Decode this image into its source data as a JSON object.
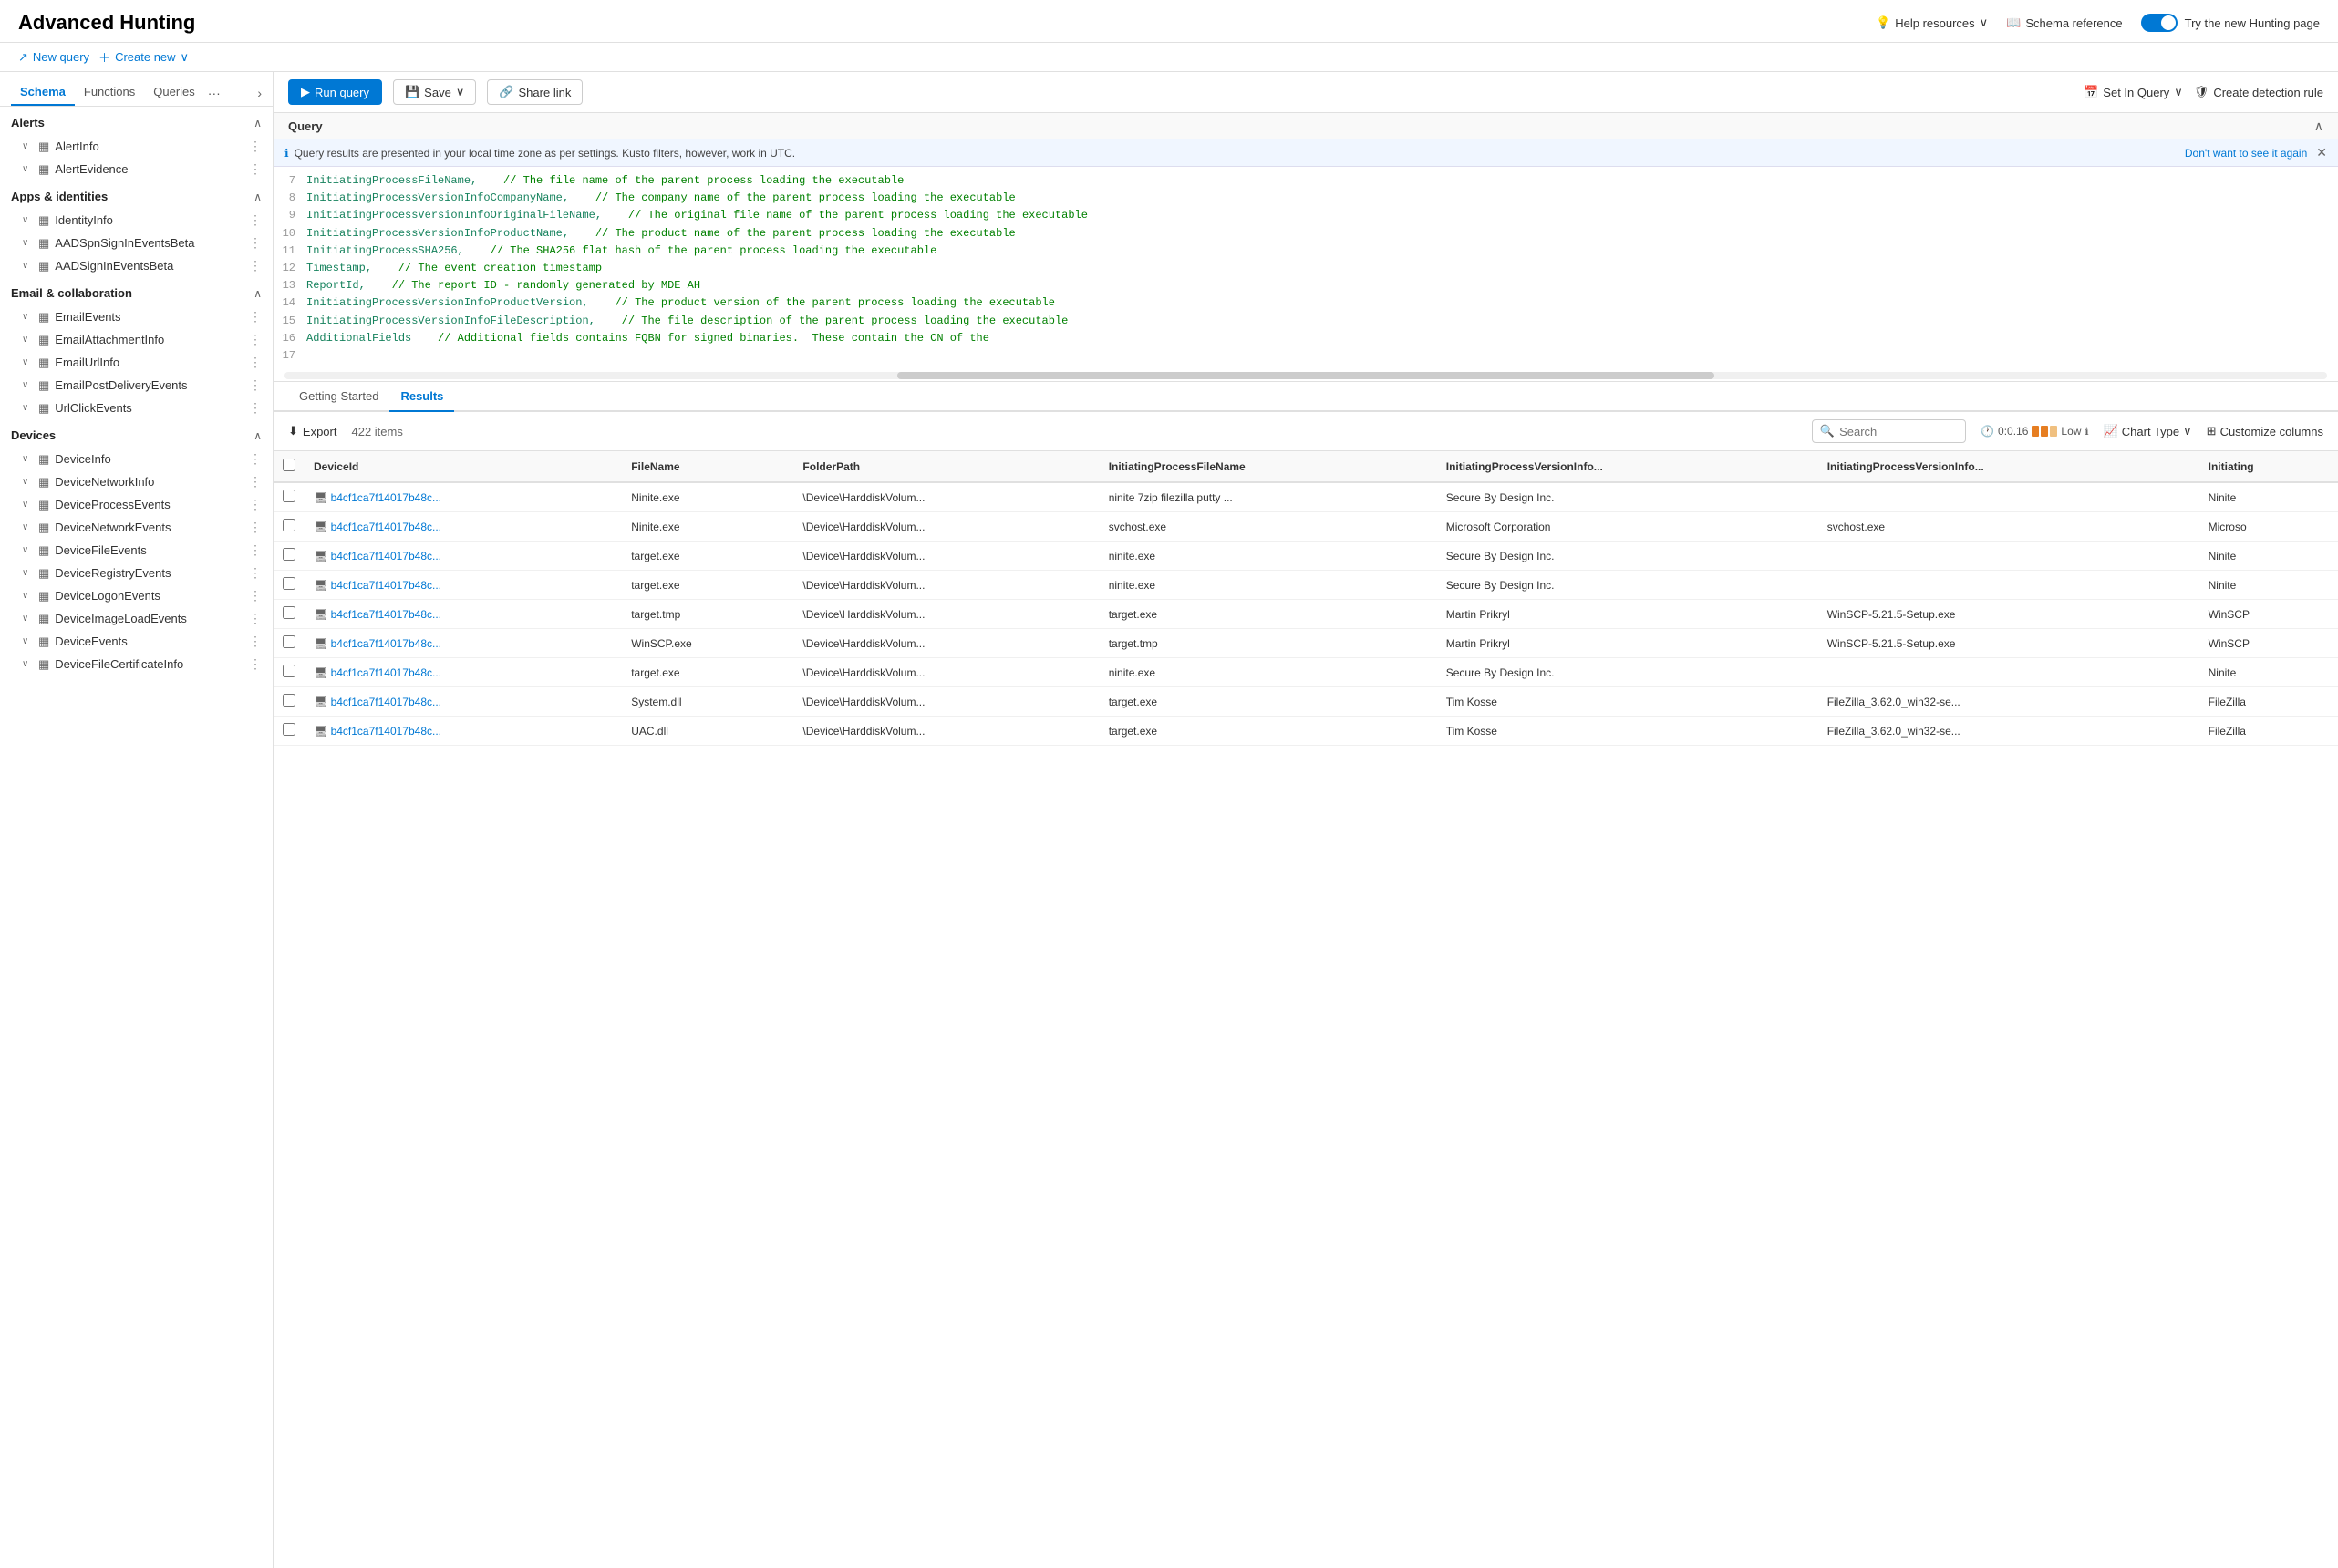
{
  "header": {
    "title": "Advanced Hunting",
    "help_resources": "Help resources",
    "schema_reference": "Schema reference",
    "try_new": "Try the new Hunting page"
  },
  "toolbar": {
    "new_query": "New query",
    "create_new": "Create new",
    "run_query": "Run query",
    "save": "Save",
    "share_link": "Share link",
    "set_in_query": "Set In Query",
    "create_detection_rule": "Create detection rule"
  },
  "sidebar": {
    "tabs": [
      "Schema",
      "Functions",
      "Queries"
    ],
    "sections": [
      {
        "title": "Alerts",
        "items": [
          {
            "label": "AlertInfo",
            "expanded": false
          },
          {
            "label": "AlertEvidence",
            "expanded": false
          }
        ]
      },
      {
        "title": "Apps & identities",
        "items": [
          {
            "label": "IdentityInfo",
            "expanded": false
          },
          {
            "label": "AADSpnSignInEventsBeta",
            "expanded": false
          },
          {
            "label": "AADSignInEventsBeta",
            "expanded": false
          }
        ]
      },
      {
        "title": "Email & collaboration",
        "items": [
          {
            "label": "EmailEvents",
            "expanded": false
          },
          {
            "label": "EmailAttachmentInfo",
            "expanded": false
          },
          {
            "label": "EmailUrlInfo",
            "expanded": false
          },
          {
            "label": "EmailPostDeliveryEvents",
            "expanded": false
          },
          {
            "label": "UrlClickEvents",
            "expanded": false
          }
        ]
      },
      {
        "title": "Devices",
        "items": [
          {
            "label": "DeviceInfo",
            "expanded": false
          },
          {
            "label": "DeviceNetworkInfo",
            "expanded": false
          },
          {
            "label": "DeviceProcessEvents",
            "expanded": false
          },
          {
            "label": "DeviceNetworkEvents",
            "expanded": false
          },
          {
            "label": "DeviceFileEvents",
            "expanded": false
          },
          {
            "label": "DeviceRegistryEvents",
            "expanded": false
          },
          {
            "label": "DeviceLogonEvents",
            "expanded": false
          },
          {
            "label": "DeviceImageLoadEvents",
            "expanded": false
          },
          {
            "label": "DeviceEvents",
            "expanded": false
          },
          {
            "label": "DeviceFileCertificateInfo",
            "expanded": false
          }
        ]
      }
    ]
  },
  "query": {
    "title": "Query",
    "notice": "Query results are presented in your local time zone as per settings. Kusto filters, however, work in UTC.",
    "dont_want": "Don't want to see it again",
    "lines": [
      {
        "num": "7",
        "code": "InitiatingProcessFileName,",
        "comment": "// The file name of the parent process loading the executable"
      },
      {
        "num": "8",
        "code": "InitiatingProcessVersionInfoCompanyName,",
        "comment": "// The company name of the parent process loading the executable"
      },
      {
        "num": "9",
        "code": "InitiatingProcessVersionInfoOriginalFileName,",
        "comment": "// The original file name of the parent process loading the executable"
      },
      {
        "num": "10",
        "code": "InitiatingProcessVersionInfoProductName,",
        "comment": "// The product name of the parent process loading the executable"
      },
      {
        "num": "11",
        "code": "InitiatingProcessSHA256,",
        "comment": "// The SHA256 flat hash of the parent process loading the executable"
      },
      {
        "num": "12",
        "code": "Timestamp,",
        "comment": "// The event creation timestamp"
      },
      {
        "num": "13",
        "code": "ReportId,",
        "comment": "// The report ID - randomly generated by MDE AH"
      },
      {
        "num": "14",
        "code": "InitiatingProcessVersionInfoProductVersion,",
        "comment": "// The product version of the parent process loading the executable"
      },
      {
        "num": "15",
        "code": "InitiatingProcessVersionInfoFileDescription,",
        "comment": "// The file description of the parent process loading the executable"
      },
      {
        "num": "16",
        "code": "AdditionalFields",
        "comment": "// Additional fields contains FQBN for signed binaries.  These contain the CN of the"
      },
      {
        "num": "17",
        "code": "",
        "comment": ""
      }
    ]
  },
  "results": {
    "tabs": [
      "Getting Started",
      "Results"
    ],
    "active_tab": "Results",
    "export_label": "Export",
    "item_count": "422 items",
    "search_placeholder": "Search",
    "timing": "0:0.16",
    "timing_label": "Low",
    "chart_type_label": "Chart Type",
    "customize_label": "Customize columns",
    "columns": [
      "DeviceId",
      "FileName",
      "FolderPath",
      "InitiatingProcessFileName",
      "InitiatingProcessVersionInfo...",
      "InitiatingProcessVersionInfo...",
      "Initiating"
    ],
    "rows": [
      {
        "deviceId": "b4cf1ca7f14017b48c...",
        "fileName": "Ninite.exe",
        "folderPath": "\\Device\\HarddiskVolum...",
        "initiatingProcessFileName": "ninite 7zip filezilla putty ...",
        "col5": "Secure By Design Inc.",
        "col6": "",
        "col7": "Ninite"
      },
      {
        "deviceId": "b4cf1ca7f14017b48c...",
        "fileName": "Ninite.exe",
        "folderPath": "\\Device\\HarddiskVolum...",
        "initiatingProcessFileName": "svchost.exe",
        "col5": "Microsoft Corporation",
        "col6": "svchost.exe",
        "col7": "Microso"
      },
      {
        "deviceId": "b4cf1ca7f14017b48c...",
        "fileName": "target.exe",
        "folderPath": "\\Device\\HarddiskVolum...",
        "initiatingProcessFileName": "ninite.exe",
        "col5": "Secure By Design Inc.",
        "col6": "",
        "col7": "Ninite"
      },
      {
        "deviceId": "b4cf1ca7f14017b48c...",
        "fileName": "target.exe",
        "folderPath": "\\Device\\HarddiskVolum...",
        "initiatingProcessFileName": "ninite.exe",
        "col5": "Secure By Design Inc.",
        "col6": "",
        "col7": "Ninite"
      },
      {
        "deviceId": "b4cf1ca7f14017b48c...",
        "fileName": "target.tmp",
        "folderPath": "\\Device\\HarddiskVolum...",
        "initiatingProcessFileName": "target.exe",
        "col5": "Martin Prikryl",
        "col6": "WinSCP-5.21.5-Setup.exe",
        "col7": "WinSCP"
      },
      {
        "deviceId": "b4cf1ca7f14017b48c...",
        "fileName": "WinSCP.exe",
        "folderPath": "\\Device\\HarddiskVolum...",
        "initiatingProcessFileName": "target.tmp",
        "col5": "Martin Prikryl",
        "col6": "WinSCP-5.21.5-Setup.exe",
        "col7": "WinSCP"
      },
      {
        "deviceId": "b4cf1ca7f14017b48c...",
        "fileName": "target.exe",
        "folderPath": "\\Device\\HarddiskVolum...",
        "initiatingProcessFileName": "ninite.exe",
        "col5": "Secure By Design Inc.",
        "col6": "",
        "col7": "Ninite"
      },
      {
        "deviceId": "b4cf1ca7f14017b48c...",
        "fileName": "System.dll",
        "folderPath": "\\Device\\HarddiskVolum...",
        "initiatingProcessFileName": "target.exe",
        "col5": "Tim Kosse",
        "col6": "FileZilla_3.62.0_win32-se...",
        "col7": "FileZilla"
      },
      {
        "deviceId": "b4cf1ca7f14017b48c...",
        "fileName": "UAC.dll",
        "folderPath": "\\Device\\HarddiskVolum...",
        "initiatingProcessFileName": "target.exe",
        "col5": "Tim Kosse",
        "col6": "FileZilla_3.62.0_win32-se...",
        "col7": "FileZilla"
      }
    ]
  }
}
